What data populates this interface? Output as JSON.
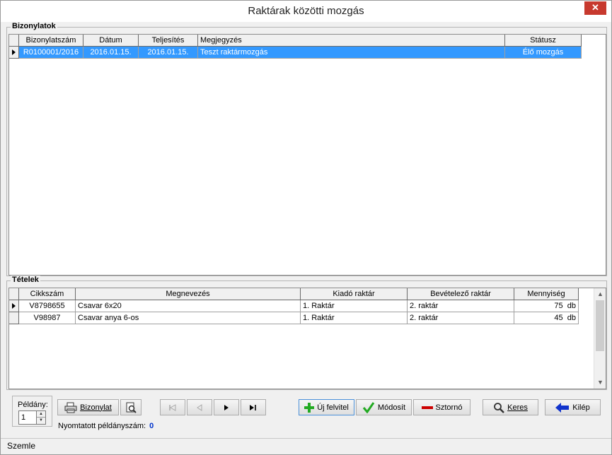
{
  "window": {
    "title": "Raktárak közötti mozgás",
    "close_glyph": "✕"
  },
  "documents": {
    "group_title": "Bizonylatok",
    "columns": [
      "Bizonylatszám",
      "Dátum",
      "Teljesítés",
      "Megjegyzés",
      "Státusz"
    ],
    "rows": [
      {
        "number": "R0100001/2016",
        "date": "2016.01.15.",
        "fulfillment": "2016.01.15.",
        "note": "Teszt raktármozgás",
        "status": "Élő mozgás"
      }
    ]
  },
  "items": {
    "group_title": "Tételek",
    "columns": [
      "Cikkszám",
      "Megnevezés",
      "Kiadó raktár",
      "Bevételező raktár",
      "Mennyiség"
    ],
    "rows": [
      {
        "sku": "V8798655",
        "name": "Csavar 6x20",
        "from": "1. Raktár",
        "to": "2. raktár",
        "qty": "75",
        "unit": "db"
      },
      {
        "sku": "V98987",
        "name": "Csavar anya 6-os",
        "from": "1. Raktár",
        "to": "2. raktár",
        "qty": "45",
        "unit": "db"
      }
    ]
  },
  "copies": {
    "label": "Példány:",
    "value": "1"
  },
  "toolbar": {
    "document_label": "Bizonylat",
    "new_label": "Új felvitel",
    "modify_label": "Módosít",
    "cancel_label": "Sztornó",
    "search_label": "Keres",
    "exit_label": "Kilép"
  },
  "printed": {
    "label": "Nyomtatott példányszám:",
    "value": "0"
  },
  "statusbar": {
    "text": "Szemle"
  },
  "colors": {
    "selection": "#3399ff",
    "accent_green": "#22aa22",
    "accent_red": "#cc0000",
    "accent_blue": "#0033cc"
  }
}
